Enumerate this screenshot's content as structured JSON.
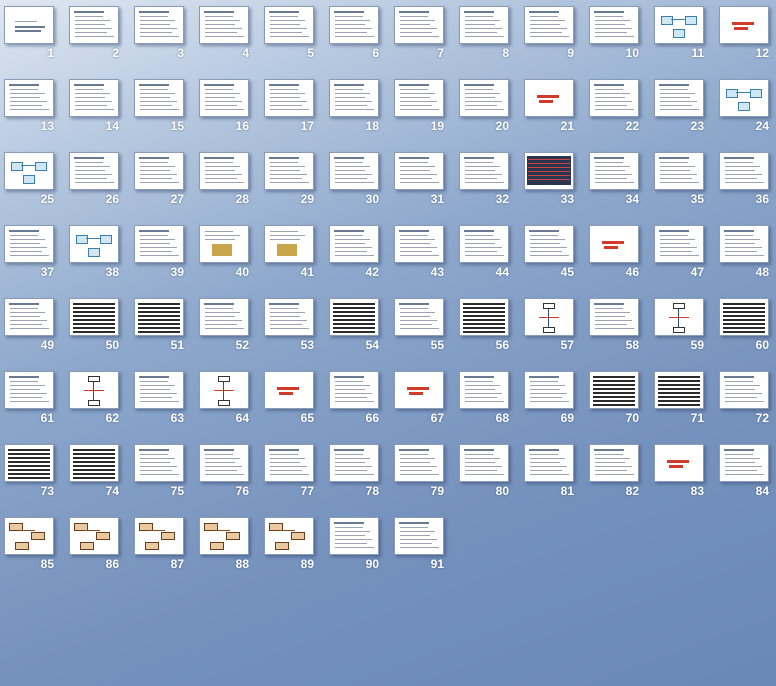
{
  "view": "slide-sorter",
  "slide_count": 91,
  "slides": [
    {
      "n": "1",
      "t": "title"
    },
    {
      "n": "2",
      "t": "text"
    },
    {
      "n": "3",
      "t": "text"
    },
    {
      "n": "4",
      "t": "text"
    },
    {
      "n": "5",
      "t": "text"
    },
    {
      "n": "6",
      "t": "text"
    },
    {
      "n": "7",
      "t": "text"
    },
    {
      "n": "8",
      "t": "text"
    },
    {
      "n": "9",
      "t": "text"
    },
    {
      "n": "10",
      "t": "text"
    },
    {
      "n": "11",
      "t": "diagram"
    },
    {
      "n": "12",
      "t": "red-title"
    },
    {
      "n": "13",
      "t": "text"
    },
    {
      "n": "14",
      "t": "text"
    },
    {
      "n": "15",
      "t": "text"
    },
    {
      "n": "16",
      "t": "text"
    },
    {
      "n": "17",
      "t": "text"
    },
    {
      "n": "18",
      "t": "text"
    },
    {
      "n": "19",
      "t": "text"
    },
    {
      "n": "20",
      "t": "text"
    },
    {
      "n": "21",
      "t": "red-title"
    },
    {
      "n": "22",
      "t": "text"
    },
    {
      "n": "23",
      "t": "text"
    },
    {
      "n": "24",
      "t": "diagram"
    },
    {
      "n": "25",
      "t": "diagram"
    },
    {
      "n": "26",
      "t": "text"
    },
    {
      "n": "27",
      "t": "text"
    },
    {
      "n": "28",
      "t": "text"
    },
    {
      "n": "29",
      "t": "text"
    },
    {
      "n": "30",
      "t": "text"
    },
    {
      "n": "31",
      "t": "text"
    },
    {
      "n": "32",
      "t": "text"
    },
    {
      "n": "33",
      "t": "table"
    },
    {
      "n": "34",
      "t": "text"
    },
    {
      "n": "35",
      "t": "text"
    },
    {
      "n": "36",
      "t": "text"
    },
    {
      "n": "37",
      "t": "text"
    },
    {
      "n": "38",
      "t": "diagram"
    },
    {
      "n": "39",
      "t": "text"
    },
    {
      "n": "40",
      "t": "image"
    },
    {
      "n": "41",
      "t": "image"
    },
    {
      "n": "42",
      "t": "text"
    },
    {
      "n": "43",
      "t": "text"
    },
    {
      "n": "44",
      "t": "text"
    },
    {
      "n": "45",
      "t": "text"
    },
    {
      "n": "46",
      "t": "red-title"
    },
    {
      "n": "47",
      "t": "text"
    },
    {
      "n": "48",
      "t": "text"
    },
    {
      "n": "49",
      "t": "text"
    },
    {
      "n": "50",
      "t": "dense"
    },
    {
      "n": "51",
      "t": "dense"
    },
    {
      "n": "52",
      "t": "text"
    },
    {
      "n": "53",
      "t": "text"
    },
    {
      "n": "54",
      "t": "dense"
    },
    {
      "n": "55",
      "t": "text"
    },
    {
      "n": "56",
      "t": "dense"
    },
    {
      "n": "57",
      "t": "axis"
    },
    {
      "n": "58",
      "t": "text"
    },
    {
      "n": "59",
      "t": "axis"
    },
    {
      "n": "60",
      "t": "dense"
    },
    {
      "n": "61",
      "t": "text"
    },
    {
      "n": "62",
      "t": "axis"
    },
    {
      "n": "63",
      "t": "text"
    },
    {
      "n": "64",
      "t": "axis"
    },
    {
      "n": "65",
      "t": "red-title"
    },
    {
      "n": "66",
      "t": "text"
    },
    {
      "n": "67",
      "t": "red-title"
    },
    {
      "n": "68",
      "t": "text"
    },
    {
      "n": "69",
      "t": "text"
    },
    {
      "n": "70",
      "t": "dense"
    },
    {
      "n": "71",
      "t": "dense"
    },
    {
      "n": "72",
      "t": "text"
    },
    {
      "n": "73",
      "t": "dense"
    },
    {
      "n": "74",
      "t": "dense"
    },
    {
      "n": "75",
      "t": "text"
    },
    {
      "n": "76",
      "t": "text"
    },
    {
      "n": "77",
      "t": "text"
    },
    {
      "n": "78",
      "t": "text"
    },
    {
      "n": "79",
      "t": "text"
    },
    {
      "n": "80",
      "t": "text"
    },
    {
      "n": "81",
      "t": "text"
    },
    {
      "n": "82",
      "t": "text"
    },
    {
      "n": "83",
      "t": "red-title"
    },
    {
      "n": "84",
      "t": "text"
    },
    {
      "n": "85",
      "t": "graph"
    },
    {
      "n": "86",
      "t": "graph"
    },
    {
      "n": "87",
      "t": "graph"
    },
    {
      "n": "88",
      "t": "graph"
    },
    {
      "n": "89",
      "t": "graph"
    },
    {
      "n": "90",
      "t": "text"
    },
    {
      "n": "91",
      "t": "text"
    }
  ]
}
